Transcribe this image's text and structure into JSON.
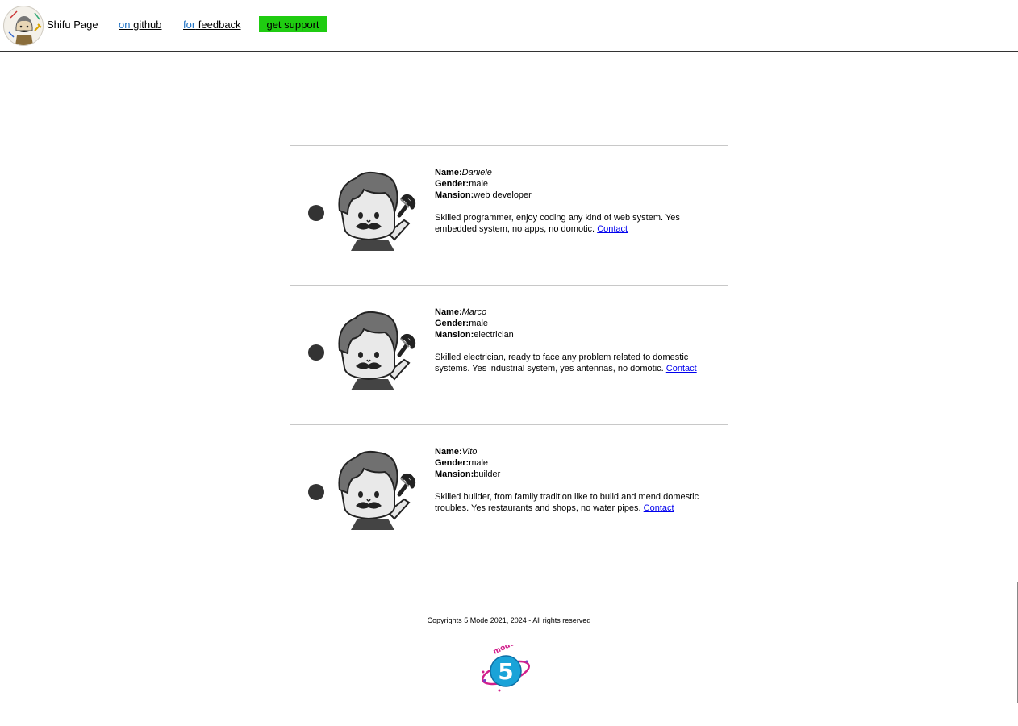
{
  "header": {
    "brand": "Shifu Page",
    "github_prefix": "on",
    "github_label": "github",
    "feedback_prefix": "for",
    "feedback_label": "feedback",
    "support_label": "get support",
    "support_color": "#1fcc11"
  },
  "labels": {
    "name": "Name:",
    "gender": "Gender:",
    "mansion": "Mansion:",
    "contact": "Contact"
  },
  "cards": [
    {
      "name": "Daniele",
      "gender": "male",
      "mansion": "web developer",
      "description": "Skilled programmer, enjoy coding any kind of web system. Yes embedded system, no apps, no domotic."
    },
    {
      "name": "Marco",
      "gender": "male",
      "mansion": "electrician",
      "description": "Skilled electrician, ready to face any problem related to domestic systems. Yes industrial system, yes antennas, no domotic."
    },
    {
      "name": "Vito",
      "gender": "male",
      "mansion": "builder",
      "description": "Skilled builder, from family tradition like to build and mend domestic troubles. Yes restaurants and shops, no water pipes."
    }
  ],
  "footer": {
    "copyright_prefix": "Copyrights",
    "company_link": "5 Mode",
    "copyright_suffix": "2021, 2024 - All rights reserved",
    "logo_text": "mode",
    "logo_numeral": "5"
  }
}
